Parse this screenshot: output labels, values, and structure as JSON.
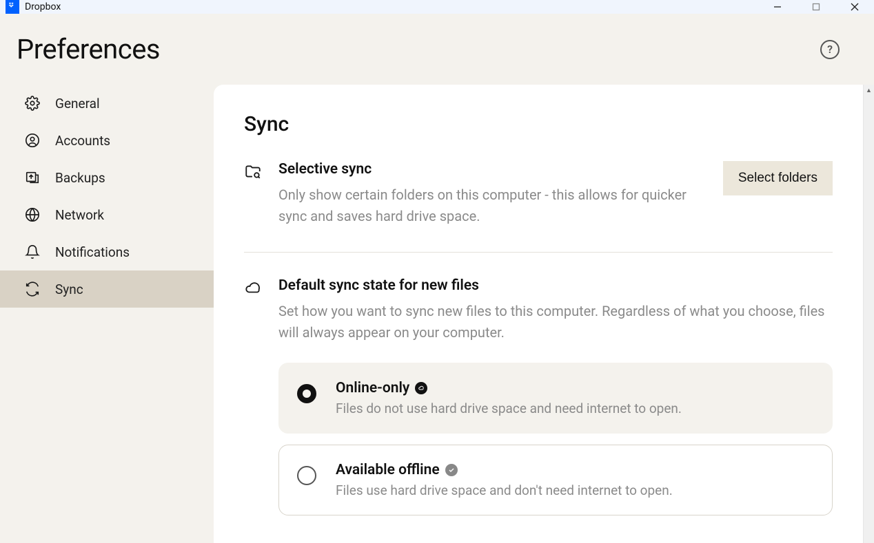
{
  "window": {
    "title": "Dropbox"
  },
  "page": {
    "title": "Preferences"
  },
  "sidebar": {
    "items": [
      {
        "label": "General"
      },
      {
        "label": "Accounts"
      },
      {
        "label": "Backups"
      },
      {
        "label": "Network"
      },
      {
        "label": "Notifications"
      },
      {
        "label": "Sync"
      }
    ],
    "active_index": 5
  },
  "main": {
    "section_title": "Sync",
    "selective_sync": {
      "title": "Selective sync",
      "description": "Only show certain folders on this computer - this allows for quicker sync and saves hard drive space.",
      "button": "Select folders"
    },
    "default_state": {
      "title": "Default sync state for new files",
      "description": "Set how you want to sync new files to this computer. Regardless of what you choose, files will always appear on your computer.",
      "options": [
        {
          "label": "Online-only",
          "description": "Files do not use hard drive space and need internet to open.",
          "selected": true
        },
        {
          "label": "Available offline",
          "description": "Files use hard drive space and don't need internet to open.",
          "selected": false
        }
      ]
    }
  }
}
